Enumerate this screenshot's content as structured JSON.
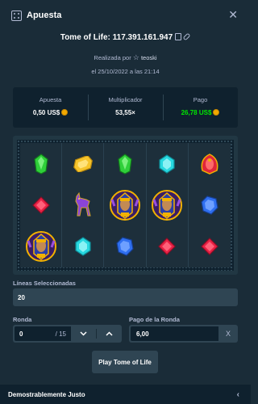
{
  "header": {
    "title": "Apuesta",
    "close_icon": "close-icon",
    "dice_icon": "dice-icon"
  },
  "game": {
    "title": "Tome of Life: 117.391.161.947",
    "copy_icon": "copy-icon",
    "link_icon": "link-icon"
  },
  "placed_by": {
    "prefix": "Realizada por",
    "user": "teoski"
  },
  "date": "el 25/10/2022 a las 21:14",
  "stats": {
    "bet_label": "Apuesta",
    "bet_value": "0,50 US$",
    "multiplier_label": "Multiplicador",
    "multiplier_value": "53,55×",
    "payout_label": "Pago",
    "payout_value": "26,78 US$"
  },
  "reels": {
    "grid": [
      [
        "green-gem",
        "yellow-gem",
        "green-gem",
        "cyan-gem",
        "red-scarab"
      ],
      [
        "red-gem",
        "purple-jackal",
        "pharaoh-wild",
        "pharaoh-wild",
        "blue-gem"
      ],
      [
        "pharaoh-wild",
        "cyan-gem",
        "blue-gem",
        "red-gem",
        "red-gem"
      ]
    ]
  },
  "lines": {
    "label": "Líneas Seleccionadas",
    "value": "20"
  },
  "round": {
    "label": "Ronda",
    "value": "0",
    "total": "/ 15"
  },
  "round_payout": {
    "label": "Pago de la Ronda",
    "value": "6,00"
  },
  "play_button": "Play Tome of Life",
  "footer": {
    "label": "Demostrablemente Justo"
  },
  "colors": {
    "accent_green": "#00e701",
    "background": "#1a2c38",
    "panel": "#0f212e"
  }
}
